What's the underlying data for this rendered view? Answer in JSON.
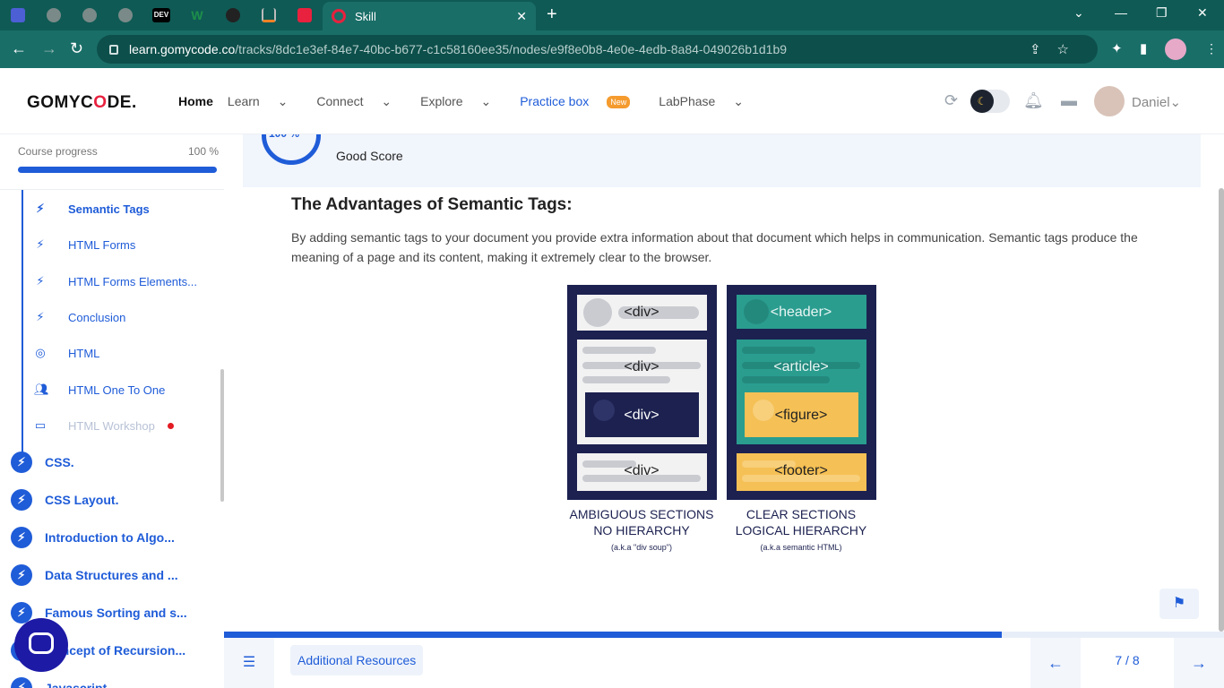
{
  "browser": {
    "tab_title": "Skill",
    "url_domain": "learn.gomycode.co",
    "url_path": "/tracks/8dc1e3ef-84e7-40bc-b677-c1c58160ee35/nodes/e9f8e0b8-4e0e-4edb-8a84-049026b1d1b9",
    "pinned_tabs": [
      {
        "icon": "app-icon",
        "color": "#4c5fd5"
      },
      {
        "icon": "globe-icon",
        "color": "#7a8a88"
      },
      {
        "icon": "globe-icon",
        "color": "#7a8a88"
      },
      {
        "icon": "globe-icon",
        "color": "#7a8a88"
      },
      {
        "icon": "dev-icon",
        "color": "#000000",
        "label": "DEV"
      },
      {
        "icon": "w-icon",
        "color": "#1d8f4a",
        "label": "W"
      },
      {
        "icon": "github-icon",
        "color": "#222222"
      },
      {
        "icon": "stack-icon",
        "color": "#f48024"
      },
      {
        "icon": "shield-icon",
        "color": "#e8213e"
      }
    ]
  },
  "header": {
    "logo": "GOMYCODE.",
    "nav": {
      "home": "Home",
      "learn": "Learn",
      "connect": "Connect",
      "explore": "Explore",
      "practice_box": "Practice box",
      "practice_badge": "New",
      "labphase": "LabPhase"
    },
    "username": "Daniel"
  },
  "sidebar": {
    "progress_label": "Course progress",
    "progress_value": "100 %",
    "progress_fraction": 1.0,
    "sub_items": [
      {
        "label": "Semantic Tags",
        "icon": "bolt-icon",
        "active": true
      },
      {
        "label": "HTML Forms",
        "icon": "bolt-icon"
      },
      {
        "label": "HTML Forms Elements...",
        "icon": "bolt-icon"
      },
      {
        "label": "Conclusion",
        "icon": "bolt-icon"
      },
      {
        "label": "HTML",
        "icon": "target-icon"
      },
      {
        "label": "HTML One To One",
        "icon": "people-icon"
      },
      {
        "label": "HTML Workshop",
        "icon": "workshop-icon",
        "dim": true,
        "dot": true
      }
    ],
    "modules": [
      {
        "label": "CSS."
      },
      {
        "label": "CSS Layout."
      },
      {
        "label": "Introduction to Algo..."
      },
      {
        "label": "Data Structures and ..."
      },
      {
        "label": "Famous Sorting and s..."
      },
      {
        "label": "Concept of Recursion..."
      },
      {
        "label": "Javascript"
      }
    ]
  },
  "score": {
    "value": "100 %",
    "text": "Good Score"
  },
  "content": {
    "heading": "The Advantages of Semantic Tags:",
    "paragraph": "By adding semantic tags to your document you provide extra information about that document which helps in communication. Semantic tags produce the meaning of a page and its content, making it extremely clear to the browser.",
    "illustration": {
      "left_tags": [
        "<div>",
        "<div>",
        "<div>",
        "<div>"
      ],
      "right_tags": [
        "<header>",
        "<article>",
        "<figure>",
        "<footer>"
      ],
      "left_caption_1": "AMBIGUOUS SECTIONS",
      "left_caption_2": "NO HIERARCHY",
      "left_caption_3": "(a.k.a \"div soup\")",
      "right_caption_1": "CLEAR SECTIONS",
      "right_caption_2": "LOGICAL HIERARCHY",
      "right_caption_3": "(a.k.a semantic HTML)"
    }
  },
  "footer": {
    "additional_resources": "Additional Resources",
    "page": "7 / 8",
    "lesson_progress_fraction": 0.78
  },
  "colors": {
    "accent": "#1f5cd8",
    "chrome": "#0f5a55",
    "badge": "#f59b2e",
    "navy": "#1c2150",
    "teal": "#2a9d8f",
    "yellow": "#f5c055"
  }
}
